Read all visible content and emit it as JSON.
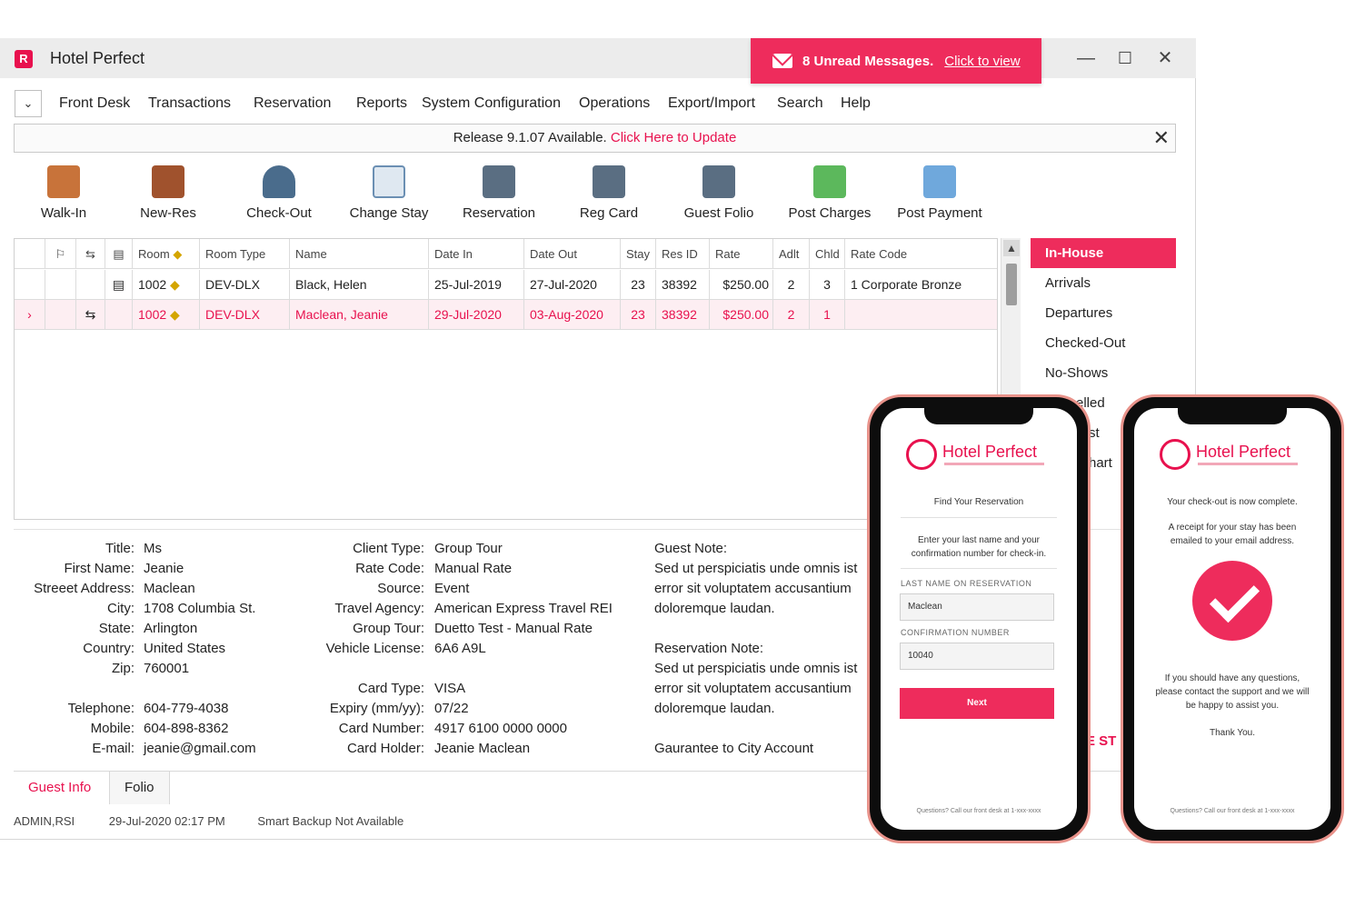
{
  "app": {
    "logo_letter": "R",
    "title": "Hotel Perfect",
    "messages": {
      "text": "8 Unread Messages.",
      "link": "Click to view"
    }
  },
  "menu": [
    "Front Desk",
    "Transactions",
    "Reservation",
    "Reports",
    "System Configuration",
    "Operations",
    "Export/Import",
    "Search",
    "Help"
  ],
  "release": {
    "text": "Release 9.1.07 Available.",
    "link": "Click Here to Update"
  },
  "toolbar": [
    {
      "label": "Walk-In",
      "icon": "walk-in-icon",
      "color": "#b5651d"
    },
    {
      "label": "New-Res",
      "icon": "phone-book-icon",
      "color": "#a0522d"
    },
    {
      "label": "Check-Out",
      "icon": "person-arrow-icon",
      "color": "#4a6c8c"
    },
    {
      "label": "Change Stay",
      "icon": "document-pencil-icon",
      "color": "#6b8fb3"
    },
    {
      "label": "Reservation",
      "icon": "printer-icon",
      "color": "#5a6e82"
    },
    {
      "label": "Reg Card",
      "icon": "printer-icon",
      "color": "#5a6e82"
    },
    {
      "label": "Guest Folio",
      "icon": "printer-icon",
      "color": "#5a6e82"
    },
    {
      "label": "Post Charges",
      "icon": "money-icon",
      "color": "#5cb85c"
    },
    {
      "label": "Post Payment",
      "icon": "credit-card-icon",
      "color": "#6fa8dc"
    }
  ],
  "grid": {
    "headers": [
      "Room",
      "Room Type",
      "Name",
      "Date In",
      "Date Out",
      "Stay",
      "Res ID",
      "Rate",
      "Adlt",
      "Chld",
      "Rate Code"
    ],
    "rows": [
      {
        "room": "1002",
        "room_type": "DEV-DLX",
        "name": "Black, Helen",
        "date_in": "25-Jul-2019",
        "date_out": "27-Jul-2020",
        "stay": "23",
        "res_id": "38392",
        "rate": "$250.00",
        "adlt": "2",
        "chld": "3",
        "rate_code": "1 Corporate Bronze"
      },
      {
        "room": "1002",
        "room_type": "DEV-DLX",
        "name": "Maclean, Jeanie",
        "date_in": "29-Jul-2020",
        "date_out": "03-Aug-2020",
        "stay": "23",
        "res_id": "38392",
        "rate": "$250.00",
        "adlt": "2",
        "chld": "1",
        "rate_code": ""
      }
    ]
  },
  "filters": [
    "In-House",
    "Arrivals",
    "Departures",
    "Checked-Out",
    "No-Shows",
    "elled",
    "st",
    "hart"
  ],
  "guest": {
    "title_label": "Title:",
    "title": "Ms",
    "first_label": "First Name:",
    "first": "Jeanie",
    "street_label": "Streeet Address:",
    "street": "Maclean",
    "city_label": "City:",
    "city": "1708 Columbia St.",
    "state_label": "State:",
    "state": "Arlington",
    "country_label": "Country:",
    "country": "United States",
    "zip_label": "Zip:",
    "zip": "760001",
    "tel_label": "Telephone:",
    "tel": "604-779-4038",
    "mobile_label": "Mobile:",
    "mobile": "604-898-8362",
    "email_label": "E-mail:",
    "email": "jeanie@gmail.com"
  },
  "booking": {
    "client_label": "Client Type:",
    "client": "Group Tour",
    "rate_label": "Rate Code:",
    "rate": "Manual Rate",
    "source_label": "Source:",
    "source": "Event",
    "agency_label": "Travel Agency:",
    "agency": "American Express Travel REI",
    "group_label": "Group Tour:",
    "group": "Duetto Test - Manual Rate",
    "vehicle_label": "Vehicle License:",
    "vehicle": "6A6 A9L",
    "card_type_label": "Card Type:",
    "card_type": "VISA",
    "expiry_label": "Expiry (mm/yy):",
    "expiry": "07/22",
    "card_num_label": "Card Number:",
    "card_num": "4917 6100 0000 0000",
    "holder_label": "Card Holder:",
    "holder": "Jeanie Maclean"
  },
  "notes": {
    "guest_label": "Guest Note:",
    "guest_l1": "Sed ut perspiciatis unde omnis ist",
    "guest_l2": "error sit voluptatem accusantium",
    "guest_l3": "doloremque laudan.",
    "res_label": "Reservation Note:",
    "res_l1": "Sed ut perspiciatis unde omnis ist",
    "res_l2": "error sit voluptatem accusantium",
    "res_l3": "doloremque laudan.",
    "guarantee": "Gaurantee to City Account",
    "fragment": "E ST"
  },
  "tabs": [
    "Guest Info",
    "Folio"
  ],
  "status": {
    "user": "ADMIN,RSI",
    "datetime": "29-Jul-2020 02:17 PM",
    "backup": "Smart Backup Not Available"
  },
  "phone1": {
    "brand": "Hotel Perfect",
    "heading": "Find Your Reservation",
    "instructions": "Enter your last name and your confirmation number for check-in.",
    "last_label": "LAST NAME ON RESERVATION",
    "last_value": "Maclean",
    "conf_label": "CONFIRMATION NUMBER",
    "conf_value": "10040",
    "button": "Next",
    "footer": "Questions? Call our front desk at 1-xxx-xxxx"
  },
  "phone2": {
    "brand": "Hotel Perfect",
    "heading": "Your check-out is now complete.",
    "receipt": "A receipt for your stay has been emailed to your email address.",
    "questions": "If you should have any questions, please contact the support and we will be happy to assist you.",
    "thanks": "Thank You.",
    "footer": "Questions? Call our front desk at 1-xxx-xxxx"
  },
  "colors": {
    "accent": "#ee2c5c",
    "accent_dark": "#e8114e"
  }
}
